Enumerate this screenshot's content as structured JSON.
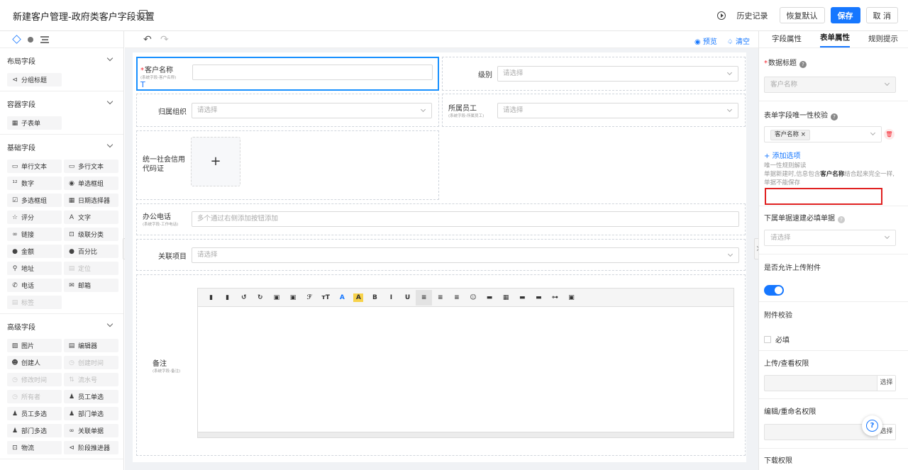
{
  "header": {
    "title": "新建客户管理-政府类客户字段设置",
    "history": "历史记录",
    "restore": "恢复默认",
    "save": "保存",
    "cancel": "取 消"
  },
  "left": {
    "groups": [
      {
        "title": "布局字段",
        "items": [
          {
            "icon": "⊲",
            "label": "分组标题",
            "disabled": false
          }
        ]
      },
      {
        "title": "容器字段",
        "items": [
          {
            "icon": "▦",
            "label": "子表单",
            "disabled": false
          }
        ]
      },
      {
        "title": "基础字段",
        "items": [
          {
            "icon": "▭",
            "label": "单行文本",
            "disabled": false
          },
          {
            "icon": "▭",
            "label": "多行文本",
            "disabled": false
          },
          {
            "icon": "¹²",
            "label": "数字",
            "disabled": false
          },
          {
            "icon": "◉",
            "label": "单选框组",
            "disabled": false
          },
          {
            "icon": "☑",
            "label": "多选框组",
            "disabled": false
          },
          {
            "icon": "▦",
            "label": "日期选择器",
            "disabled": false
          },
          {
            "icon": "☆",
            "label": "评分",
            "disabled": false
          },
          {
            "icon": "A",
            "label": "文字",
            "disabled": false
          },
          {
            "icon": "∞",
            "label": "链接",
            "disabled": false
          },
          {
            "icon": "⊡",
            "label": "级联分类",
            "disabled": false
          },
          {
            "icon": "●",
            "label": "金额",
            "disabled": false
          },
          {
            "icon": "●",
            "label": "百分比",
            "disabled": false
          },
          {
            "icon": "⚲",
            "label": "地址",
            "disabled": false
          },
          {
            "icon": "▤",
            "label": "定位",
            "disabled": true
          },
          {
            "icon": "✆",
            "label": "电话",
            "disabled": false
          },
          {
            "icon": "✉",
            "label": "邮箱",
            "disabled": false
          },
          {
            "icon": "▤",
            "label": "标签",
            "disabled": true
          }
        ]
      },
      {
        "title": "高级字段",
        "items": [
          {
            "icon": "▨",
            "label": "图片",
            "disabled": false
          },
          {
            "icon": "▤",
            "label": "编辑器",
            "disabled": false
          },
          {
            "icon": "☻",
            "label": "创建人",
            "disabled": false
          },
          {
            "icon": "◷",
            "label": "创建时间",
            "disabled": true
          },
          {
            "icon": "◷",
            "label": "修改时间",
            "disabled": true
          },
          {
            "icon": "⇅",
            "label": "流水号",
            "disabled": true
          },
          {
            "icon": "◷",
            "label": "所有者",
            "disabled": true
          },
          {
            "icon": "♟",
            "label": "员工单选",
            "disabled": false
          },
          {
            "icon": "♟",
            "label": "员工多选",
            "disabled": false
          },
          {
            "icon": "♟",
            "label": "部门单选",
            "disabled": false
          },
          {
            "icon": "♟",
            "label": "部门多选",
            "disabled": false
          },
          {
            "icon": "∞",
            "label": "关联单据",
            "disabled": false
          },
          {
            "icon": "⊡",
            "label": "物流",
            "disabled": false
          },
          {
            "icon": "⊲",
            "label": "阶段推进器",
            "disabled": false
          }
        ]
      }
    ]
  },
  "canvas": {
    "preview": "◉ 预览",
    "clear": "♤ 清空",
    "undo": "↶",
    "redo": "↷",
    "fields": {
      "customer_name": {
        "label": "客户名称",
        "sub": "(系统字段-客户名称)"
      },
      "level": {
        "label": "级别",
        "placeholder": "请选择"
      },
      "org": {
        "label": "归属组织",
        "placeholder": "请选择"
      },
      "staff": {
        "label": "所属员工",
        "sub": "(系统字段-所属员工)",
        "placeholder": "请选择"
      },
      "credit": {
        "label": "统一社会信用代码证",
        "plus": "+"
      },
      "phone": {
        "label": "办公电话",
        "sub": "(系统字段-工作电话)",
        "placeholder": "多个通过右侧添加按钮添加"
      },
      "project": {
        "label": "关联项目",
        "placeholder": "请选择"
      },
      "remark": {
        "label": "备注",
        "sub": "(系统字段-备注)"
      }
    },
    "editor_tools": [
      "▮",
      "▮",
      "↺",
      "↻",
      "▣",
      "▣",
      "ℱ",
      "ᴛT",
      "A",
      "A",
      "B",
      "I",
      "U",
      "≡",
      "≡",
      "≡",
      "☺",
      "▬",
      "▦",
      "▬",
      "▬",
      "⊶",
      "▣"
    ]
  },
  "right": {
    "tabs": [
      "字段属性",
      "表单属性",
      "规则提示"
    ],
    "data_title": "数据标题",
    "data_title_value": "客户名称",
    "unique_check": "表单字段唯一性校验",
    "tag": "客户名称 ×",
    "add_option": "+ 添加选项",
    "note_a": "唯一性规则解读",
    "note_b": "单据新建时,信息包含",
    "note_bold": "客户名称",
    "note_c": "结合起来完全一样,单据不能保存",
    "sub_form": "下属单据速建必填单据",
    "sub_form_placeholder": "请选择",
    "allow_upload": "是否允许上传附件",
    "attach_check": "附件校验",
    "required": "必填",
    "upload_perm": "上传/查看权限",
    "choose": "选择",
    "edit_perm": "编辑/重命名权限",
    "download_perm": "下载权限"
  }
}
